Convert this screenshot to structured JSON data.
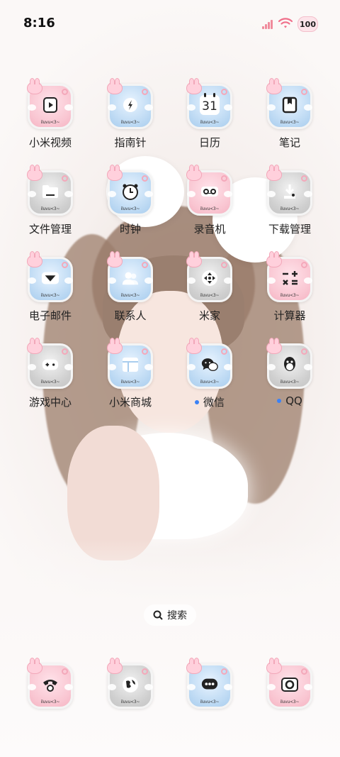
{
  "status": {
    "time": "8:16",
    "battery": "100",
    "signal_color": "#f08b9c",
    "wifi_color": "#f06f8a"
  },
  "apps": [
    {
      "label": "小米视频",
      "tag": "iluvu<3~",
      "icon": "play-icon"
    },
    {
      "label": "指南针",
      "tag": "iluvu<3~",
      "icon": "compass-icon"
    },
    {
      "label": "日历",
      "tag": "iluvu<3~",
      "icon": "calendar-icon",
      "day": "31"
    },
    {
      "label": "笔记",
      "tag": "iluvu<3~",
      "icon": "notes-icon"
    },
    {
      "label": "文件管理",
      "tag": "iluvu<3~",
      "icon": "folder-icon"
    },
    {
      "label": "时钟",
      "tag": "iluvu<3~",
      "icon": "clock-icon"
    },
    {
      "label": "录音机",
      "tag": "iluvu<3~",
      "icon": "recorder-icon"
    },
    {
      "label": "下载管理",
      "tag": "iluvu<3~",
      "icon": "download-icon"
    },
    {
      "label": "电子邮件",
      "tag": "iluvu<3~",
      "icon": "mail-icon"
    },
    {
      "label": "联系人",
      "tag": "iluvu<3~",
      "icon": "contacts-icon"
    },
    {
      "label": "米家",
      "tag": "iluvu<3~",
      "icon": "smart-home-icon"
    },
    {
      "label": "计算器",
      "tag": "iluvu<3~",
      "icon": "calculator-icon"
    },
    {
      "label": "游戏中心",
      "tag": "iluvu<3~",
      "icon": "gamepad-icon"
    },
    {
      "label": "小米商城",
      "tag": "iluvu<3~",
      "icon": "store-icon"
    },
    {
      "label": "微信",
      "tag": "iluvu<3~",
      "icon": "wechat-icon",
      "badge": true
    },
    {
      "label": "QQ",
      "tag": "iluvu<3~",
      "icon": "qq-icon",
      "badge": true
    }
  ],
  "search": {
    "label": "搜索"
  },
  "dock": [
    {
      "tag": "iluvu<3~",
      "icon": "phone-icon"
    },
    {
      "tag": "iluvu<3~",
      "icon": "browser-icon"
    },
    {
      "tag": "iluvu<3~",
      "icon": "messages-icon"
    },
    {
      "tag": "iluvu<3~",
      "icon": "camera-icon"
    }
  ]
}
